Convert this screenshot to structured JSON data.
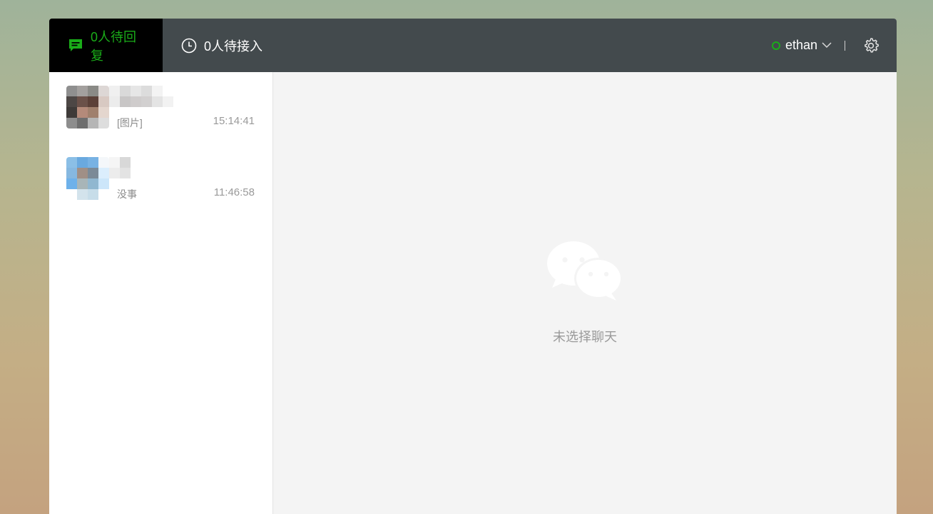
{
  "header": {
    "tabs": [
      {
        "label": "0人待回复",
        "active": true,
        "icon": "chat-bubble-icon"
      },
      {
        "label": "0人待接入",
        "active": false,
        "icon": "clock-icon"
      }
    ],
    "user": {
      "name": "ethan",
      "status_color": "#1aad19"
    },
    "settings_icon": "gear-icon"
  },
  "conversations": [
    {
      "preview": "[图片]",
      "time": "15:14:41"
    },
    {
      "preview": "没事",
      "time": "11:46:58"
    }
  ],
  "empty_state": {
    "icon": "wechat-icon",
    "text": "未选择聊天"
  },
  "colors": {
    "accent": "#1aad19",
    "topbar": "#434a4d",
    "active_tab": "#000000"
  }
}
